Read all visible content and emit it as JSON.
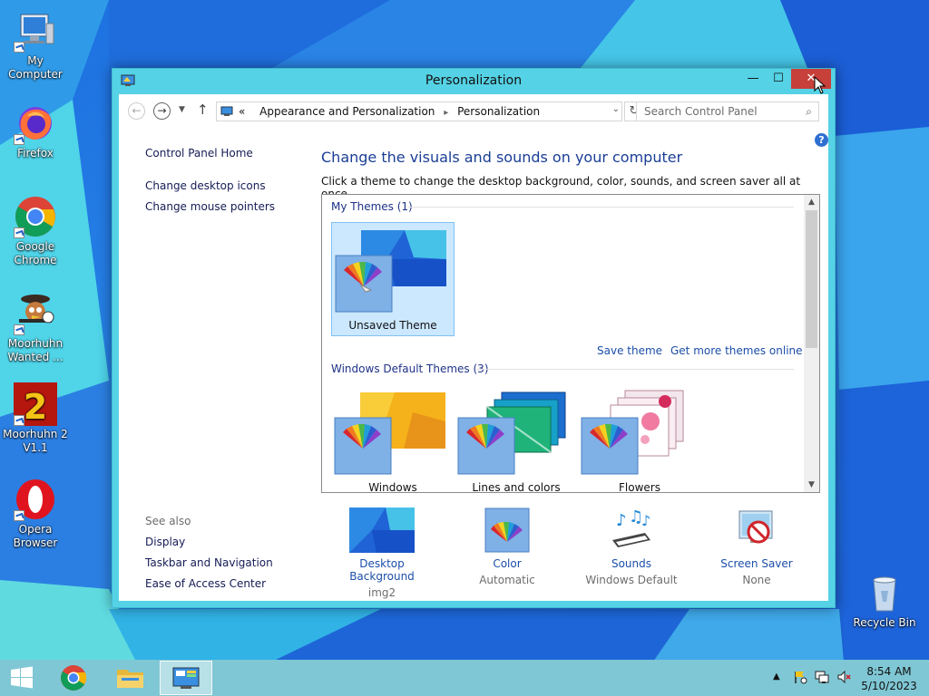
{
  "desktop": {
    "icons": [
      {
        "label": "My Computer",
        "icon": "computer-icon"
      },
      {
        "label": "Firefox",
        "icon": "firefox-icon"
      },
      {
        "label": "Google Chrome",
        "icon": "chrome-icon"
      },
      {
        "label": "Moorhuhn Wanted ...",
        "icon": "moorhuhn-wanted-icon"
      },
      {
        "label": "Moorhuhn 2 V1.1",
        "icon": "moorhuhn-2-icon"
      },
      {
        "label": "Opera Browser",
        "icon": "opera-icon"
      },
      {
        "label": "Recycle Bin",
        "icon": "recycle-bin-icon"
      }
    ]
  },
  "window": {
    "title": "Personalization",
    "buttons": {
      "minimize": "—",
      "maximize": "☐",
      "close": "✕"
    },
    "address": {
      "overflow": "«",
      "crumbs": [
        "Appearance and Personalization",
        "Personalization"
      ]
    },
    "search_placeholder": "Search Control Panel",
    "left_nav": {
      "home": "Control Panel Home",
      "links": [
        "Change desktop icons",
        "Change mouse pointers"
      ],
      "see_also_label": "See also",
      "see_also": [
        "Display",
        "Taskbar and Navigation",
        "Ease of Access Center"
      ]
    },
    "main": {
      "heading": "Change the visuals and sounds on your computer",
      "subheading": "Click a theme to change the desktop background, color, sounds, and screen saver all at once.",
      "my_themes_label": "My Themes (1)",
      "my_themes": [
        {
          "label": "Unsaved Theme",
          "selected": true
        }
      ],
      "save_theme": "Save theme",
      "more_themes": "Get more themes online",
      "default_themes_label": "Windows Default Themes (3)",
      "default_themes": [
        {
          "label": "Windows"
        },
        {
          "label": "Lines and colors"
        },
        {
          "label": "Flowers"
        }
      ]
    },
    "bottom": [
      {
        "label": "Desktop Background",
        "value": "img2"
      },
      {
        "label": "Color",
        "value": "Automatic"
      },
      {
        "label": "Sounds",
        "value": "Windows Default"
      },
      {
        "label": "Screen Saver",
        "value": "None"
      }
    ]
  },
  "taskbar": {
    "apps": [
      "chrome-icon",
      "file-explorer-icon",
      "control-panel-icon"
    ],
    "active_app": "control-panel-icon",
    "time": "8:54 AM",
    "date": "5/10/2023"
  },
  "colors": {
    "window_frame": "#55d2e5",
    "close_button": "#c7403a",
    "link": "#1c4ea8",
    "heading": "#1a3e96",
    "taskbar": "#7fc7d4"
  }
}
